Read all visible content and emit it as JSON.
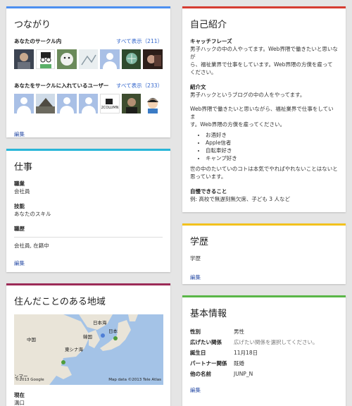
{
  "colors": {
    "tsunagari": "#4d8ff0",
    "shigoto": "#29b6d8",
    "chiiki": "#9c2b57",
    "jiko": "#d63d32",
    "gakureki": "#f3c21d",
    "kihon": "#5ab748",
    "link": "#3366cc",
    "edit": "#3355aa"
  },
  "tsunagari": {
    "title": "つながり",
    "circle_label": "あなたのサークル内",
    "circle_seeall": "すべて表示（211）",
    "added_label": "あなたをサークルに入れているユーザー",
    "added_seeall": "すべて表示（233）",
    "avatar_caption": "2COLUMN",
    "edit": "編集"
  },
  "shigoto": {
    "title": "仕事",
    "shokugyo_label": "職業",
    "shokugyo_value": "会社員",
    "gino_label": "技能",
    "gino_value": "あなたのスキル",
    "shokureki_label": "職歴",
    "shokureki_value": "会社員, 在籍中",
    "edit": "編集"
  },
  "chiiki": {
    "title": "住んだことのある地域",
    "map_labels": {
      "nihonkai": "日本海",
      "kankoku": "韓国",
      "chugoku": "中国",
      "nihon": "日本",
      "higashishinakai": "東シナ海",
      "myanmar": "ンマー",
      "copyright": "©2013 Google",
      "mapdata": "Map data ©2013 Tele Atlas"
    },
    "genzai_label": "現在",
    "genzai_value": "溝口"
  },
  "jiko": {
    "title": "自己紹介",
    "catch_label": "キャッチフレーズ",
    "catch_lines": [
      "男子ハックの中の人やってます。Web界隈で働きたいと思いなが",
      "ら、福祉業界で仕事をしています。Web界隈の方僕を雇って",
      "ください。"
    ],
    "intro_label": "紹介文",
    "intro_line1": "男子ハックというブログの中の人をやってます。",
    "intro_lines2": [
      "Web界隈で働きたいと思いながら、福祉業界で仕事をしていま",
      "す。Web界隈の方僕を雇ってください。"
    ],
    "bullets": [
      "お酒好き",
      "Apple信者",
      "自転車好き",
      "キャンプ好き"
    ],
    "closing_lines": [
      "世の中のたいていのコトは本気でやればやれないことはないと",
      "思っています。"
    ],
    "pride_label": "自慢できること",
    "pride_placeholder": "例: 高校で無遅刻無欠席、子ども 3 人など",
    "edit": "編集"
  },
  "gakureki": {
    "title": "学歴",
    "placeholder": "学歴",
    "edit": "編集"
  },
  "kihon": {
    "title": "基本情報",
    "rows": [
      {
        "k": "性別",
        "v": "男性"
      },
      {
        "k": "広げたい関係",
        "v": "広げたい関係を選択してください。"
      },
      {
        "k": "誕生日",
        "v": "11月18日"
      },
      {
        "k": "パートナー関係",
        "v": "既婚"
      },
      {
        "k": "他の名前",
        "v": "JUNP_N"
      }
    ],
    "edit": "編集"
  }
}
